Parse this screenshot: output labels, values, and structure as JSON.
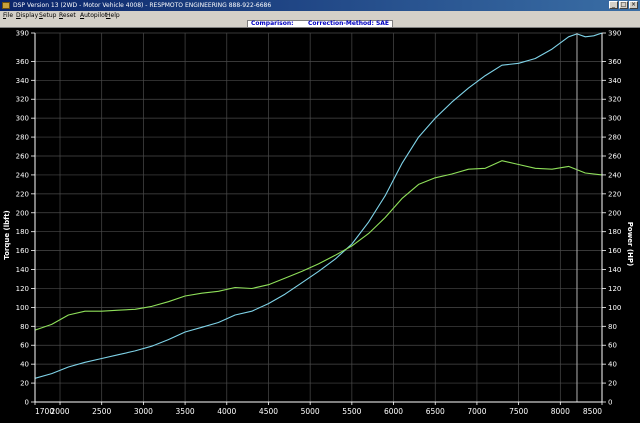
{
  "window": {
    "title": "DSP Version 13 (2WD - Motor Vehicle 4008) - RESPMOTO ENGINEERING 888-922-6686"
  },
  "menu": {
    "items": [
      "File",
      "Display",
      "Setup",
      "Reset",
      "Autopilot",
      "Help"
    ]
  },
  "status": {
    "comparison": "Comparison:",
    "correction": "Correction-Method: SAE"
  },
  "colors": {
    "background": "#000000",
    "grid": "#4a4a4a",
    "axis_text": "#ffffff",
    "power_series": "#7fd3e8",
    "torque_series": "#8fe05a",
    "cursor": "#b0b0b0"
  },
  "chart_data": {
    "type": "line",
    "xlabel": "",
    "ylabel_left": "Torque (lbft)",
    "ylabel_right": "Power (HP)",
    "xlim": [
      1700,
      8500
    ],
    "ylim": [
      0,
      390
    ],
    "x_ticks": [
      1700,
      2000,
      2500,
      3000,
      3500,
      4000,
      4500,
      5000,
      5500,
      6000,
      6500,
      7000,
      7500,
      8000,
      8500
    ],
    "y_ticks": [
      0,
      20,
      40,
      60,
      80,
      100,
      120,
      140,
      160,
      180,
      200,
      220,
      240,
      260,
      280,
      300,
      320,
      340,
      360,
      390
    ],
    "grid": true,
    "cursor_x": 8200,
    "series": [
      {
        "role": "power",
        "x": [
          1700,
          1900,
          2100,
          2300,
          2500,
          2700,
          2900,
          3100,
          3300,
          3500,
          3700,
          3900,
          4100,
          4300,
          4500,
          4700,
          4900,
          5100,
          5300,
          5500,
          5700,
          5900,
          6000,
          6100,
          6300,
          6500,
          6700,
          6900,
          7100,
          7300,
          7500,
          7700,
          7900,
          8100,
          8200,
          8300,
          8400,
          8500
        ],
        "y": [
          25,
          30,
          37,
          42,
          46,
          50,
          54,
          59,
          66,
          74,
          79,
          84,
          92,
          96,
          104,
          114,
          126,
          138,
          151,
          167,
          190,
          218,
          235,
          252,
          280,
          300,
          317,
          332,
          345,
          356,
          358,
          363,
          373,
          386,
          389,
          386,
          387,
          392
        ]
      },
      {
        "role": "torque",
        "x": [
          1700,
          1900,
          2100,
          2300,
          2500,
          2700,
          2900,
          3100,
          3300,
          3500,
          3700,
          3900,
          4100,
          4300,
          4500,
          4700,
          4900,
          5100,
          5300,
          5500,
          5700,
          5900,
          6100,
          6300,
          6500,
          6700,
          6900,
          7100,
          7300,
          7500,
          7700,
          7900,
          8100,
          8300,
          8500
        ],
        "y": [
          76,
          82,
          92,
          96,
          96,
          97,
          98,
          101,
          106,
          112,
          115,
          117,
          121,
          120,
          124,
          131,
          138,
          146,
          155,
          165,
          178,
          195,
          215,
          230,
          237,
          241,
          246,
          247,
          255,
          251,
          247,
          246,
          249,
          242,
          240
        ]
      }
    ]
  }
}
